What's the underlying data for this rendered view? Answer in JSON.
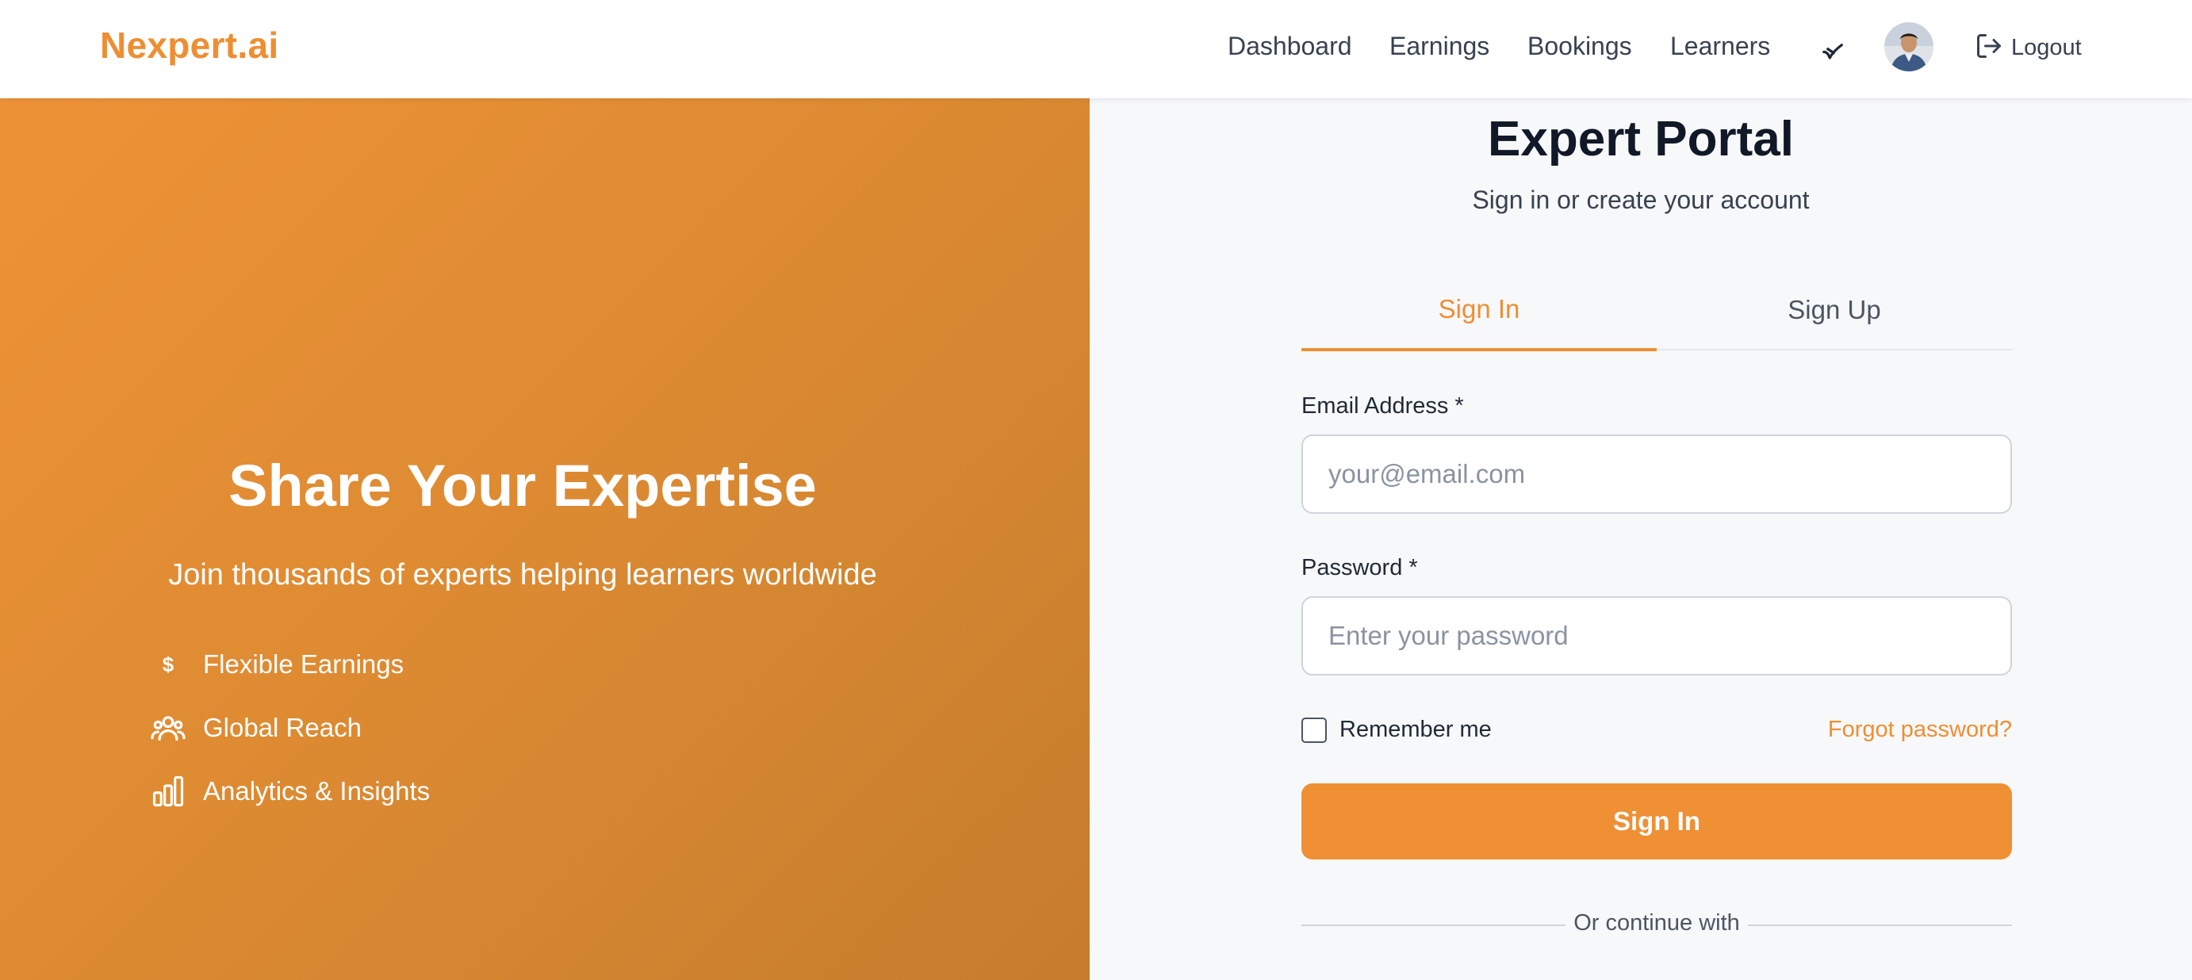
{
  "header": {
    "logo": "Nexpert.ai",
    "nav": [
      "Dashboard",
      "Earnings",
      "Bookings",
      "Learners"
    ],
    "logout_label": "Logout",
    "icons": {
      "theme": "feather-icon",
      "logout": "logout-icon"
    }
  },
  "hero": {
    "title": "Share Your Expertise",
    "subtitle": "Join thousands of experts helping learners worldwide",
    "features": [
      {
        "icon": "dollar-icon",
        "label": "Flexible Earnings"
      },
      {
        "icon": "users-icon",
        "label": "Global Reach"
      },
      {
        "icon": "bar-chart-icon",
        "label": "Analytics & Insights"
      }
    ],
    "colors": {
      "gradient_start": "#ee9236",
      "gradient_end": "#c57d2d"
    }
  },
  "portal": {
    "title": "Expert Portal",
    "subtitle": "Sign in or create your account",
    "tabs": [
      {
        "label": "Sign In",
        "active": true
      },
      {
        "label": "Sign Up",
        "active": false
      }
    ],
    "email": {
      "label": "Email Address *",
      "placeholder": "your@email.com",
      "value": ""
    },
    "password": {
      "label": "Password *",
      "placeholder": "Enter your password",
      "value": ""
    },
    "remember_label": "Remember me",
    "remember_checked": false,
    "forgot_label": "Forgot password?",
    "submit_label": "Sign In",
    "divider_label": "Or continue with",
    "accent_color": "#ee8e33"
  }
}
